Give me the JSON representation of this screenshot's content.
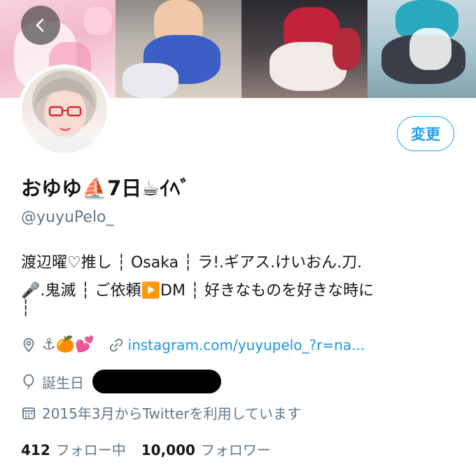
{
  "profile": {
    "edit_label": "変更",
    "display_name": "おゆゆ⛵7日☕ｲﾍﾞ",
    "handle": "@yuyuPelo_",
    "bio_line1": "渡辺曜♡推し ┆ Osaka ┆ ラ!.ギアス.けいおん.刀.",
    "bio_line2": "🎤.鬼滅 ┆ ご依頼▶️DM ┆ 好きなものを好きな時に",
    "bio_line3": "┆",
    "location": "⚓🍊💕",
    "website": "instagram.com/yuyupelo_?r=na...",
    "birthday_label": "誕生日",
    "joined": "2015年3月からTwitterを利用しています",
    "following_count": "412",
    "following_label": "フォロー中",
    "followers_count": "10,000",
    "followers_label": "フォロワー"
  },
  "icons": {
    "back": "chevron-left-icon",
    "location": "location-pin-icon",
    "link": "link-icon",
    "birthday": "balloon-icon",
    "calendar": "calendar-icon"
  },
  "colors": {
    "accent": "#1da1f2",
    "link": "#1b95e0",
    "secondary_text": "#657786",
    "primary_text": "#14171a"
  }
}
